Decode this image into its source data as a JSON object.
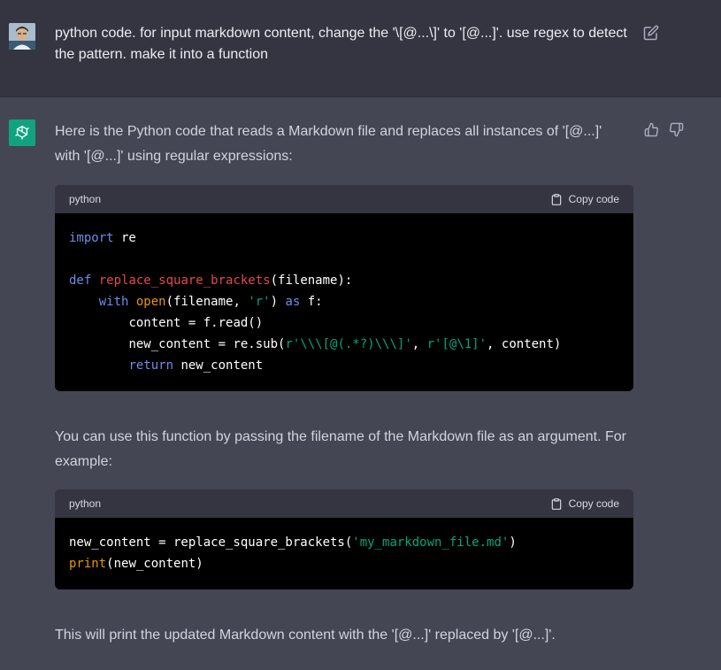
{
  "user_message": {
    "text": "python code. for input markdown content, change the '\\[@...\\]' to '[@...]'. use regex to detect the pattern. make it into a function"
  },
  "assistant_message": {
    "intro": "Here is the Python code that reads a Markdown file and replaces all instances of '[@...]' with '[@...]' using regular expressions:",
    "middle": "You can use this function by passing the filename of the Markdown file as an argument. For example:",
    "closing": "This will print the updated Markdown content with the '[@...]' replaced by '[@...]'."
  },
  "code_blocks": [
    {
      "language": "python",
      "copy_label": "Copy code",
      "lines": {
        "l1_kw": "import",
        "l1_rest": " re",
        "l3_kw": "def",
        "l3_fn": "replace_square_brackets",
        "l3_rest": "(filename):",
        "l4_kw": "with",
        "l4_bi": "open",
        "l4_a": "(filename, ",
        "l4_st": "'r'",
        "l4_b": ") ",
        "l4_kw2": "as",
        "l4_c": " f:",
        "l5": "content = f.read()",
        "l6_a": "new_content = re.sub(",
        "l6_st1": "r'\\\\\\[@(.*?)\\\\\\]'",
        "l6_b": ", ",
        "l6_st2": "r'[@\\1]'",
        "l6_c": ", content)",
        "l7_kw": "return",
        "l7_rest": " new_content"
      }
    },
    {
      "language": "python",
      "copy_label": "Copy code",
      "lines": {
        "l1_a": "new_content = replace_square_brackets(",
        "l1_st": "'my_markdown_file.md'",
        "l1_b": ")",
        "l2_bi": "print",
        "l2_rest": "(new_content)"
      }
    }
  ],
  "colors": {
    "user_bg": "#343541",
    "assistant_bg": "#444654",
    "gpt_avatar": "#10a37f",
    "keyword": "#6c8ee8",
    "function_name": "#e5484d",
    "builtin": "#e9950c",
    "string": "#00a67d"
  },
  "icons": {
    "edit": "pencil-square-icon",
    "thumbs_up": "thumbs-up-icon",
    "thumbs_down": "thumbs-down-icon",
    "copy": "clipboard-icon",
    "assistant": "openai-logo-icon"
  }
}
